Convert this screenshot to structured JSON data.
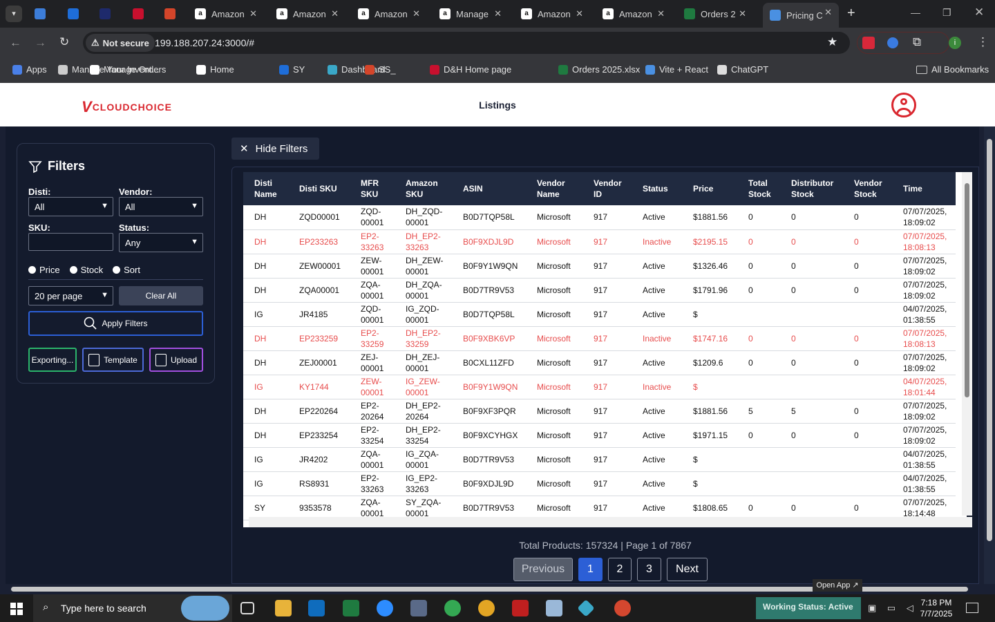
{
  "browser": {
    "tabs": [
      {
        "label": "",
        "icon": "arrow-left-icon"
      },
      {
        "label": "",
        "icon": "ec-favicon"
      },
      {
        "label": "",
        "icon": "ku-favicon"
      },
      {
        "label": "",
        "icon": "dh-favicon"
      },
      {
        "label": "",
        "icon": "ss-favicon"
      },
      {
        "label": "Amazon",
        "icon": "amazon-icon"
      },
      {
        "label": "Amazon",
        "icon": "amazon-icon"
      },
      {
        "label": "Amazon",
        "icon": "amazon-icon"
      },
      {
        "label": "Manage",
        "icon": "amazon-icon"
      },
      {
        "label": "Amazon",
        "icon": "amazon-icon"
      },
      {
        "label": "Amazon",
        "icon": "amazon-icon"
      },
      {
        "label": "Orders 2",
        "icon": "excel-icon"
      },
      {
        "label": "Pricing C",
        "icon": "dollar-icon"
      }
    ],
    "security_label": "Not secure",
    "url": "199.188.207.24:3000/#",
    "bookmarks": [
      "Apps",
      "Manage Your Invent...",
      "Manage Orders",
      "Home",
      "SY",
      "Dashboard",
      "SS_",
      "D&H Home page",
      "Orders 2025.xlsx",
      "Vite + React",
      "ChatGPT"
    ],
    "all_bookmarks": "All Bookmarks",
    "profile_initial": "i"
  },
  "app": {
    "logo": "CLOUDCHOICE",
    "logo_prefix": "V",
    "page_title": "Listings"
  },
  "filters": {
    "hide_label": "Hide Filters",
    "title": "Filters",
    "disti_label": "Disti:",
    "disti_value": "All",
    "vendor_label": "Vendor:",
    "vendor_value": "All",
    "sku_label": "SKU:",
    "sku_value": "",
    "status_label": "Status:",
    "status_value": "Any",
    "radio_price": "Price",
    "radio_stock": "Stock",
    "radio_sort": "Sort",
    "per_page": "20 per page",
    "clear_all": "Clear All",
    "apply": "Apply Filters",
    "exporting": "Exporting...",
    "template": "Template",
    "upload": "Upload"
  },
  "table": {
    "headers": [
      "Disti Name",
      "Disti SKU",
      "MFR SKU",
      "Amazon SKU",
      "ASIN",
      "Vendor Name",
      "Vendor ID",
      "Status",
      "Price",
      "Total Stock",
      "Distributor Stock",
      "Vendor Stock",
      "Time"
    ],
    "rows": [
      {
        "disti": "DH",
        "disti_sku": "ZQD00001",
        "mfr_sku": "ZQD-\n00001",
        "amazon_sku": "DH_ZQD-\n00001",
        "asin": "B0D7TQP58L",
        "vendor": "Microsoft",
        "vendor_id": "917",
        "status": "Active",
        "price": "$1881.56",
        "total": "0",
        "dist": "0",
        "vstock": "0",
        "time": "07/07/2025,\n18:09:02",
        "inactive": false
      },
      {
        "disti": "DH",
        "disti_sku": "EP233263",
        "mfr_sku": "EP2-\n33263",
        "amazon_sku": "DH_EP2-\n33263",
        "asin": "B0F9XDJL9D",
        "vendor": "Microsoft",
        "vendor_id": "917",
        "status": "Inactive",
        "price": "$2195.15",
        "total": "0",
        "dist": "0",
        "vstock": "0",
        "time": "07/07/2025,\n18:08:13",
        "inactive": true
      },
      {
        "disti": "DH",
        "disti_sku": "ZEW00001",
        "mfr_sku": "ZEW-\n00001",
        "amazon_sku": "DH_ZEW-\n00001",
        "asin": "B0F9Y1W9QN",
        "vendor": "Microsoft",
        "vendor_id": "917",
        "status": "Active",
        "price": "$1326.46",
        "total": "0",
        "dist": "0",
        "vstock": "0",
        "time": "07/07/2025,\n18:09:02",
        "inactive": false
      },
      {
        "disti": "DH",
        "disti_sku": "ZQA00001",
        "mfr_sku": "ZQA-\n00001",
        "amazon_sku": "DH_ZQA-\n00001",
        "asin": "B0D7TR9V53",
        "vendor": "Microsoft",
        "vendor_id": "917",
        "status": "Active",
        "price": "$1791.96",
        "total": "0",
        "dist": "0",
        "vstock": "0",
        "time": "07/07/2025,\n18:09:02",
        "inactive": false
      },
      {
        "disti": "IG",
        "disti_sku": "JR4185",
        "mfr_sku": "ZQD-\n00001",
        "amazon_sku": "IG_ZQD-\n00001",
        "asin": "B0D7TQP58L",
        "vendor": "Microsoft",
        "vendor_id": "917",
        "status": "Active",
        "price": "$",
        "total": "",
        "dist": "",
        "vstock": "",
        "time": "04/07/2025,\n01:38:55",
        "inactive": false
      },
      {
        "disti": "DH",
        "disti_sku": "EP233259",
        "mfr_sku": "EP2-\n33259",
        "amazon_sku": "DH_EP2-\n33259",
        "asin": "B0F9XBK6VP",
        "vendor": "Microsoft",
        "vendor_id": "917",
        "status": "Inactive",
        "price": "$1747.16",
        "total": "0",
        "dist": "0",
        "vstock": "0",
        "time": "07/07/2025,\n18:08:13",
        "inactive": true
      },
      {
        "disti": "DH",
        "disti_sku": "ZEJ00001",
        "mfr_sku": "ZEJ-\n00001",
        "amazon_sku": "DH_ZEJ-\n00001",
        "asin": "B0CXL11ZFD",
        "vendor": "Microsoft",
        "vendor_id": "917",
        "status": "Active",
        "price": "$1209.6",
        "total": "0",
        "dist": "0",
        "vstock": "0",
        "time": "07/07/2025,\n18:09:02",
        "inactive": false
      },
      {
        "disti": "IG",
        "disti_sku": "KY1744",
        "mfr_sku": "ZEW-\n00001",
        "amazon_sku": "IG_ZEW-\n00001",
        "asin": "B0F9Y1W9QN",
        "vendor": "Microsoft",
        "vendor_id": "917",
        "status": "Inactive",
        "price": "$",
        "total": "",
        "dist": "",
        "vstock": "",
        "time": "04/07/2025,\n18:01:44",
        "inactive": true
      },
      {
        "disti": "DH",
        "disti_sku": "EP220264",
        "mfr_sku": "EP2-\n20264",
        "amazon_sku": "DH_EP2-\n20264",
        "asin": "B0F9XF3PQR",
        "vendor": "Microsoft",
        "vendor_id": "917",
        "status": "Active",
        "price": "$1881.56",
        "total": "5",
        "dist": "5",
        "vstock": "0",
        "time": "07/07/2025,\n18:09:02",
        "inactive": false
      },
      {
        "disti": "DH",
        "disti_sku": "EP233254",
        "mfr_sku": "EP2-\n33254",
        "amazon_sku": "DH_EP2-\n33254",
        "asin": "B0F9XCYHGX",
        "vendor": "Microsoft",
        "vendor_id": "917",
        "status": "Active",
        "price": "$1971.15",
        "total": "0",
        "dist": "0",
        "vstock": "0",
        "time": "07/07/2025,\n18:09:02",
        "inactive": false
      },
      {
        "disti": "IG",
        "disti_sku": "JR4202",
        "mfr_sku": "ZQA-\n00001",
        "amazon_sku": "IG_ZQA-\n00001",
        "asin": "B0D7TR9V53",
        "vendor": "Microsoft",
        "vendor_id": "917",
        "status": "Active",
        "price": "$",
        "total": "",
        "dist": "",
        "vstock": "",
        "time": "04/07/2025,\n01:38:55",
        "inactive": false
      },
      {
        "disti": "IG",
        "disti_sku": "RS8931",
        "mfr_sku": "EP2-\n33263",
        "amazon_sku": "IG_EP2-\n33263",
        "asin": "B0F9XDJL9D",
        "vendor": "Microsoft",
        "vendor_id": "917",
        "status": "Active",
        "price": "$",
        "total": "",
        "dist": "",
        "vstock": "",
        "time": "04/07/2025,\n01:38:55",
        "inactive": false
      },
      {
        "disti": "SY",
        "disti_sku": "9353578",
        "mfr_sku": "ZQA-\n00001",
        "amazon_sku": "SY_ZQA-\n00001",
        "asin": "B0D7TR9V53",
        "vendor": "Microsoft",
        "vendor_id": "917",
        "status": "Active",
        "price": "$1808.65",
        "total": "0",
        "dist": "0",
        "vstock": "0",
        "time": "07/07/2025,\n18:14:48",
        "inactive": false
      }
    ]
  },
  "pagination": {
    "summary": "Total Products: 157324 | Page 1 of 7867",
    "previous": "Previous",
    "pages": [
      "1",
      "2",
      "3"
    ],
    "next": "Next"
  },
  "taskbar": {
    "search_placeholder": "Type here to search",
    "open_app": "Open App ↗",
    "working_status": "Working Status: Active",
    "time": "7:18 PM",
    "date": "7/7/2025"
  },
  "colors": {
    "accent": "#2c5fd6",
    "inactive": "#e74c4c",
    "logo_red": "#d9262e"
  }
}
